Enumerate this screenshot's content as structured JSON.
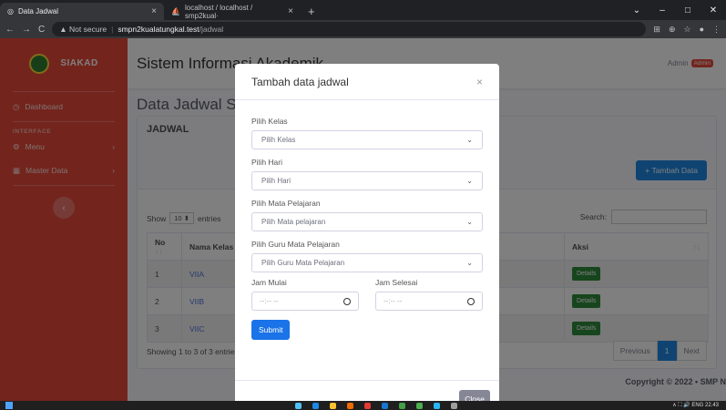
{
  "browser": {
    "tabs": [
      {
        "title": "Data Jadwal",
        "active": true
      },
      {
        "title": "localhost / localhost / smp2kual·",
        "active": false
      }
    ],
    "new_tab": "+",
    "window_controls": [
      "⌄",
      "–",
      "□",
      "✕"
    ],
    "nav": [
      "←",
      "→",
      "C"
    ],
    "not_secure": "▲ Not secure",
    "url_host": "smpn2kualatungkal.test",
    "url_path": "/jadwal"
  },
  "sidebar": {
    "brand": "SIAKAD",
    "items": [
      {
        "label": "Dashboard"
      },
      {
        "label": "Menu"
      },
      {
        "label": "Master Data"
      }
    ],
    "heading": "INTERFACE",
    "toggle": "‹",
    "color": "#e74a3b"
  },
  "topbar": {
    "app_title": "Sistem Informasi Akademik",
    "user": "Admin",
    "badge": "Admin"
  },
  "main": {
    "page_heading": "Data Jadwal SMP",
    "card_title": "JADWAL",
    "add_button": "+ Tambah Data",
    "show_label": "Show",
    "length_value": "10",
    "entries_label": "entries",
    "search_label": "Search:",
    "table": {
      "headers": [
        "No",
        "Nama Kelas",
        "",
        "Aksi"
      ],
      "rows": [
        {
          "no": "1",
          "kelas": "VIIA",
          "action": "Details"
        },
        {
          "no": "2",
          "kelas": "VIIB",
          "action": "Details"
        },
        {
          "no": "3",
          "kelas": "VIIC",
          "action": "Details"
        }
      ]
    },
    "info": "Showing 1 to 3 of 3 entries",
    "pagination": {
      "prev": "Previous",
      "current": "1",
      "next": "Next"
    },
    "footer": "Copyright © 2022 • SMP N"
  },
  "modal": {
    "title": "Tambah data jadwal",
    "close_icon": "×",
    "fields": {
      "kelas_label": "Pilih Kelas",
      "kelas_value": "Pilih Kelas",
      "hari_label": "Pilih Hari",
      "hari_value": "Pilih Hari",
      "mapel_label": "Pilih Mata Pelajaran",
      "mapel_value": "Pilih Mata pelajaran",
      "guru_label": "Pilih Guru Mata Pelajaran",
      "guru_value": "Pilih Guru Mata Pelajaran",
      "jam_mulai_label": "Jam Mulai",
      "jam_mulai_value": "--:-- --",
      "jam_selesai_label": "Jam Selesai",
      "jam_selesai_value": "--:-- --"
    },
    "submit": "Submit",
    "close_button": "Close"
  },
  "taskbar": {
    "tray": "∧  ⛶  🔊  ENG  22.43"
  }
}
